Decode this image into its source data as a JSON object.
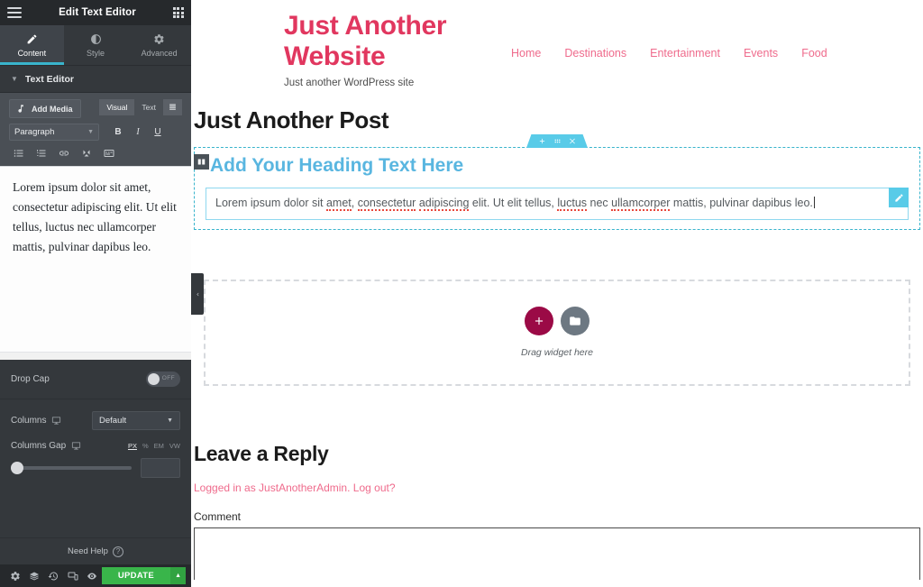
{
  "panel": {
    "title": "Edit Text Editor",
    "menu_icon": "hamburger-icon",
    "widgets_icon": "grid-icon",
    "tabs": [
      {
        "label": "Content",
        "icon": "pencil-icon",
        "active": true
      },
      {
        "label": "Style",
        "icon": "contrast-icon",
        "active": false
      },
      {
        "label": "Advanced",
        "icon": "gear-icon",
        "active": false
      }
    ],
    "section": {
      "label": "Text Editor",
      "expanded": true
    },
    "wp_editor": {
      "add_media_label": "Add Media",
      "mode_tabs": [
        {
          "label": "Visual",
          "active": true
        },
        {
          "label": "Text",
          "active": false
        }
      ],
      "paragraph_select": "Paragraph",
      "format_buttons": [
        "B",
        "I",
        "U"
      ],
      "row2_icons": [
        "unordered-list-icon",
        "ordered-list-icon",
        "link-icon",
        "fullscreen-icon",
        "kitchen-sink-icon"
      ],
      "content": "Lorem ipsum dolor sit amet, consectetur adipiscing elit. Ut elit tellus, luctus nec ullamcorper mattis, pulvinar dapibus leo."
    },
    "controls": {
      "drop_cap_label": "Drop Cap",
      "drop_cap_state": "OFF",
      "columns_label": "Columns",
      "columns_value": "Default",
      "columns_gap_label": "Columns Gap",
      "units": [
        "PX",
        "%",
        "EM",
        "VW"
      ],
      "active_unit": "PX",
      "gap_value": ""
    },
    "footer": {
      "need_help": "Need Help",
      "icons": [
        "gear-icon",
        "layers-icon",
        "history-icon",
        "responsive-icon",
        "preview-icon"
      ],
      "update_label": "UPDATE",
      "update_arrow": "chevron-up-icon"
    }
  },
  "preview": {
    "site_title": "Just Another Website",
    "tagline": "Just another WordPress site",
    "nav": [
      "Home",
      "Destinations",
      "Entertainment",
      "Events",
      "Food"
    ],
    "post_title": "Just Another Post",
    "section_handle_icons": [
      "plus-icon",
      "drag-dots-icon",
      "close-icon"
    ],
    "column_badge_icon": "columns-icon",
    "heading_widget": "Add Your Heading Text Here",
    "text_widget": {
      "before": "Lorem ipsum dolor sit ",
      "misspelled_1": "amet",
      "mid_1": ", ",
      "misspelled_2": "consectetur",
      "mid_2": " ",
      "misspelled_3": "adipiscing",
      "mid_3": " elit. Ut elit tellus, ",
      "misspelled_4": "luctus",
      "mid_4": " nec ",
      "misspelled_5": "ullamcorper",
      "after": " mattis, pulvinar dapibus leo."
    },
    "edit_pencil_icon": "pencil-icon",
    "dropzone": {
      "label": "Drag widget here",
      "add_icon": "plus-icon",
      "folder_icon": "folder-icon"
    },
    "reply_title": "Leave a Reply",
    "logged_in_text": "Logged in as JustAnotherAdmin.",
    "logout_link": "Log out?",
    "comment_label": "Comment",
    "collapse_icon": "chevron-left-icon"
  },
  "colors": {
    "brand_pink": "#e1375f",
    "nav_pink": "#ef6b8c",
    "elementor_cyan": "#59cbe8",
    "heading_blue": "#59b6e0",
    "update_green": "#39b54a",
    "add_circle": "#9b0a46",
    "panel_bg": "#34383c"
  }
}
